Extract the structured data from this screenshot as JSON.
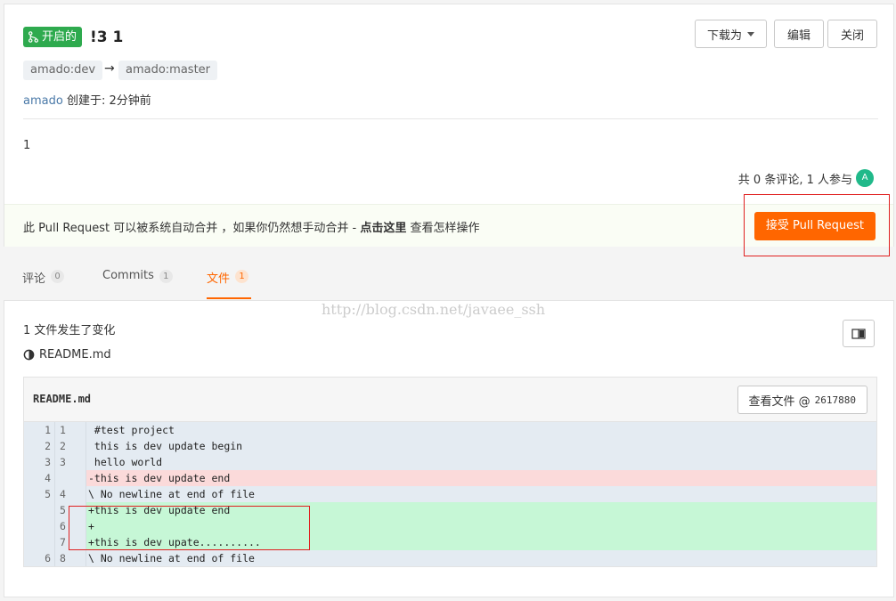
{
  "pr": {
    "status_label": "开启的",
    "title": "!3 1",
    "source_branch": "amado:dev",
    "arrow": "→",
    "target_branch": "amado:master",
    "author": "amado",
    "created_label": "创建于: 2分钟前",
    "description": "1",
    "comment_summary": "共 0 条评论, 1 人参与",
    "avatar_letter": "A"
  },
  "actions": {
    "download_label": "下载为",
    "edit_label": "编辑",
    "close_label": "关闭"
  },
  "merge": {
    "text_before": "此 Pull Request 可以被系统自动合并 ，如果你仍然想手动合并 - ",
    "link_text": "点击这里",
    "text_after": " 查看怎样操作",
    "accept_label": "接受 Pull Request"
  },
  "tabs": [
    {
      "label": "评论",
      "count": "0"
    },
    {
      "label": "Commits",
      "count": "1"
    },
    {
      "label": "文件",
      "count": "1"
    }
  ],
  "files": {
    "watermark": "http://blog.csdn.net/javaee_ssh",
    "changes_summary": "1 文件发生了变化",
    "file_name": "README.md",
    "diff_filename": "README.md",
    "view_file_label": "查看文件 @",
    "commit_sha": "2617880"
  },
  "diff_rows": [
    {
      "old": "1",
      "new": "1",
      "code": " #test project",
      "type": "ctx"
    },
    {
      "old": "2",
      "new": "2",
      "code": " this is dev update begin",
      "type": "ctx"
    },
    {
      "old": "3",
      "new": "3",
      "code": " hello world",
      "type": "ctx"
    },
    {
      "old": "4",
      "new": "",
      "code": "-this is dev update end",
      "type": "del"
    },
    {
      "old": "5",
      "new": "4",
      "code": "\\ No newline at end of file",
      "type": "ctx"
    },
    {
      "old": "",
      "new": "5",
      "code": "+this is dev update end",
      "type": "add"
    },
    {
      "old": "",
      "new": "6",
      "code": "+",
      "type": "add"
    },
    {
      "old": "",
      "new": "7",
      "code": "+this is dev upate..........",
      "type": "add"
    },
    {
      "old": "6",
      "new": "8",
      "code": "\\ No newline at end of file",
      "type": "ctx"
    }
  ],
  "colors": {
    "status_green": "#2eaa4e",
    "accent_orange": "#ff6600",
    "annotation_red": "#e02020"
  },
  "icons": {
    "merge": "git-merge-icon",
    "caret": "chevron-down-icon",
    "toggle": "split-view-icon",
    "file": "half-circle-file-icon"
  }
}
